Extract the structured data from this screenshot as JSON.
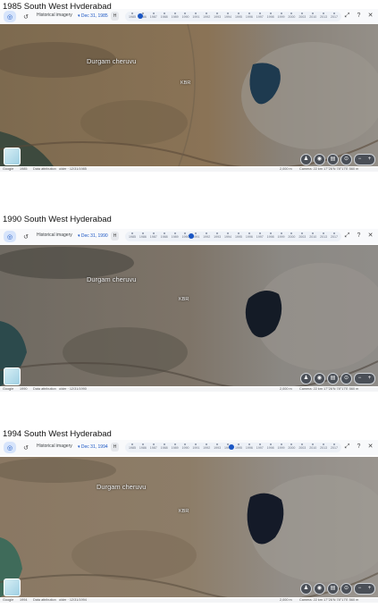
{
  "panels": [
    {
      "title": "1985 South West Hyderabad",
      "hist_label": "Historical imagery",
      "date": "Dec 31, 1985",
      "place_label": "Durgam cheruvu",
      "kbr_label": "KBR",
      "slider_fraction": 0.04,
      "status": {
        "google": "Google",
        "year": "1985",
        "attribution": "Data attribution",
        "older": "older · 12/31/1985",
        "scale": "2,000 m",
        "camera": "Camera: 22 km",
        "coords": "17°26'N 78°17'E 560 m"
      }
    },
    {
      "title": "1990 South West Hyderabad",
      "hist_label": "Historical imagery",
      "date": "Dec 31, 1990",
      "place_label": "Durgam cheruvu",
      "kbr_label": "KBR",
      "slider_fraction": 0.29,
      "status": {
        "google": "Google",
        "year": "1990",
        "attribution": "Data attribution",
        "older": "older · 12/31/1990",
        "scale": "2,000 m",
        "camera": "Camera: 22 km",
        "coords": "17°26'N 78°17'E 560 m"
      }
    },
    {
      "title": "1994 South West Hyderabad",
      "hist_label": "Historical imagery",
      "date": "Dec 31, 1994",
      "place_label": "Durgam cheruvu",
      "kbr_label": "KBR",
      "slider_fraction": 0.49,
      "status": {
        "google": "Google",
        "year": "1994",
        "attribution": "Data attribution",
        "older": "older · 12/31/1994",
        "scale": "2,000 m",
        "camera": "Camera: 22 km",
        "coords": "17°26'N 78°17'E 560 m"
      }
    }
  ],
  "timeline_years": [
    "1985",
    "1986",
    "1987",
    "1988",
    "1989",
    "1990",
    "1991",
    "1992",
    "1993",
    "1994",
    "1995",
    "1996",
    "1997",
    "1998",
    "1999",
    "2000",
    "2003",
    "2010",
    "2013",
    "2017"
  ],
  "icons": {
    "earth": "earth-icon",
    "history": "history-icon",
    "expand": "expand-icon",
    "help": "help-icon",
    "close": "close-icon",
    "pegman": "pegman-icon",
    "compass": "compass-icon",
    "layers": "layers-icon"
  },
  "colors": {
    "accent": "#1a56c4",
    "terrain": "#8a7459",
    "urban": "#8d8a86",
    "water": "#1c2d3d"
  }
}
